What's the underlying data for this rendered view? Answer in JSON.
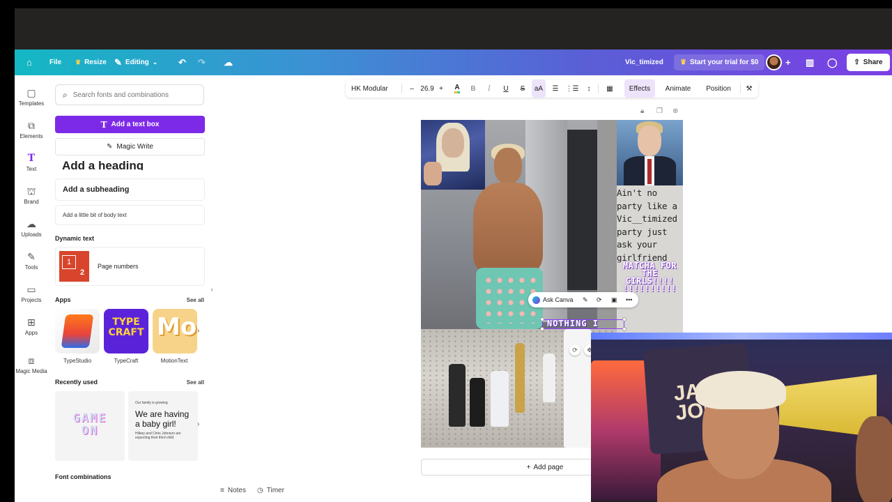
{
  "header": {
    "file": "File",
    "resize": "Resize",
    "editing": "Editing",
    "doc_title": "Vic_timized",
    "trial": "Start your trial for $0",
    "share": "Share"
  },
  "rail": {
    "items": [
      {
        "label": "Templates",
        "icon": "templates-icon"
      },
      {
        "label": "Elements",
        "icon": "elements-icon"
      },
      {
        "label": "Text",
        "icon": "text-icon"
      },
      {
        "label": "Brand",
        "icon": "brand-icon"
      },
      {
        "label": "Uploads",
        "icon": "uploads-icon"
      },
      {
        "label": "Tools",
        "icon": "tools-icon"
      },
      {
        "label": "Projects",
        "icon": "projects-icon"
      },
      {
        "label": "Apps",
        "icon": "apps-icon"
      },
      {
        "label": "Magic Media",
        "icon": "magic-media-icon"
      }
    ]
  },
  "panel": {
    "search_placeholder": "Search fonts and combinations",
    "add_text_box": "Add a text box",
    "magic_write": "Magic Write",
    "add_heading": "Add a heading",
    "add_subheading": "Add a subheading",
    "add_body": "Add a little bit of body text",
    "dynamic_text": "Dynamic text",
    "page_numbers": "Page numbers",
    "apps_title": "Apps",
    "see_all": "See all",
    "apps": [
      {
        "name": "TypeStudio"
      },
      {
        "name": "TypeCraft"
      },
      {
        "name": "MotionText"
      }
    ],
    "recently_used": "Recently used",
    "recent": {
      "game_on": "GAME ON",
      "baby_small": "Our family is growing",
      "baby_big": "We are having a baby girl!",
      "baby_foot": "Hillary and Chris Johnson are expecting their third child"
    },
    "font_combinations": "Font combinations"
  },
  "toolbar": {
    "font": "HK Modular",
    "size": "26.9",
    "effects": "Effects",
    "animate": "Animate",
    "position": "Position"
  },
  "design": {
    "quote": "Ain't no party like a Vic__timized party just ask your girlfriend",
    "matcha": "MATCHA FOR THE GIRLS!!!! !!!!!!!!!!",
    "selected_text": "NOTHING I"
  },
  "ask_bar": {
    "label": "Ask Canva"
  },
  "footer": {
    "add_page": "Add page",
    "notes": "Notes",
    "timer": "Timer"
  },
  "colors": {
    "accent": "#7d2ae8",
    "header_start": "#14b8c4",
    "header_end": "#7b3fe4"
  }
}
